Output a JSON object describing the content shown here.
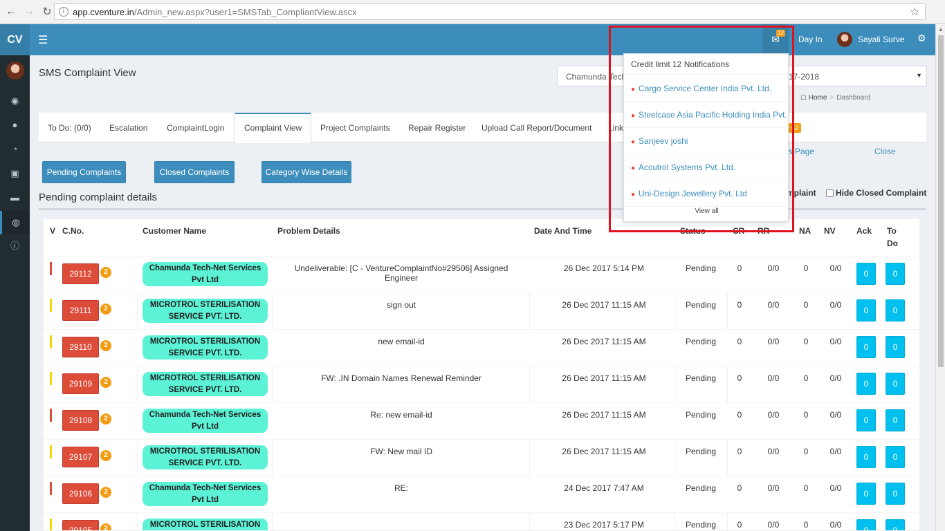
{
  "browser": {
    "url_host": "app.cventure.in",
    "url_path": "/Admin_new.aspx?user1=SMSTab_CompliantView.ascx"
  },
  "sidebar": {
    "logo": "CV"
  },
  "header": {
    "notification_count": "12",
    "day_in": "Day In",
    "user_name": "Sayali Surve"
  },
  "page": {
    "title": "SMS Complaint View",
    "company_select_left": "Chamunda Tech-",
    "company_select_right": "17-2018",
    "breadcrumb_home": "Home",
    "breadcrumb_current": "Dashboard"
  },
  "tabs": [
    {
      "label": "To Do: (0/0)"
    },
    {
      "label": "Escalation"
    },
    {
      "label": "ComplaintLogin"
    },
    {
      "label": "Complaint View"
    },
    {
      "label": "Project Complaints"
    },
    {
      "label": "Repair Register"
    },
    {
      "label": "Upload Call Report/Document"
    },
    {
      "label": "Link"
    },
    {
      "label": "o"
    }
  ],
  "tab_badge": "62",
  "links": {
    "page": "ls Page",
    "close": "Close"
  },
  "buttons": {
    "pending": "Pending Complaints",
    "closed": "Closed Complaints",
    "category": "Category Wise Details"
  },
  "section": {
    "title": "Pending complaint details",
    "hide_partial": "mplaint",
    "hide_closed": "Hide Closed Complaint"
  },
  "table": {
    "headers": {
      "v": "V",
      "cno": "C.No.",
      "customer": "Customer Name",
      "problem": "Problem Details",
      "date": "Date And Time",
      "status": "Status",
      "cr": "CR",
      "rr": "RR",
      "na": "NA",
      "nv": "NV",
      "ack": "Ack",
      "todo_1": "To",
      "todo_2": "Do"
    },
    "rows": [
      {
        "cno": "29112",
        "count": "2",
        "customer": "Chamunda Tech-Net Services Pvt Ltd",
        "problem": "Undeliverable: [C - VentureComplaintNo#29506] Assigned Engineer",
        "date": "26 Dec 2017 5:14 PM",
        "status": "Pending",
        "cr": "0",
        "rr": "0/0",
        "na": "0",
        "nv": "0/0",
        "ack": "0",
        "todo": "0",
        "flag": "#dd4b39"
      },
      {
        "cno": "29111",
        "count": "2",
        "customer": "MICROTROL STERILISATION SERVICE PVT. LTD.",
        "problem": "sign out",
        "date": "26 Dec 2017 11:15 AM",
        "status": "Pending",
        "cr": "0",
        "rr": "0/0",
        "na": "0",
        "nv": "0/0",
        "ack": "0",
        "todo": "0",
        "flag": "#f5d800"
      },
      {
        "cno": "29110",
        "count": "2",
        "customer": "MICROTROL STERILISATION SERVICE PVT. LTD.",
        "problem": "new email-id",
        "date": "26 Dec 2017 11:15 AM",
        "status": "Pending",
        "cr": "0",
        "rr": "0/0",
        "na": "0",
        "nv": "0/0",
        "ack": "0",
        "todo": "0",
        "flag": "#f5d800"
      },
      {
        "cno": "29109",
        "count": "2",
        "customer": "MICROTROL STERILISATION SERVICE PVT. LTD.",
        "problem": "FW: .IN Domain Names Renewal Reminder",
        "date": "26 Dec 2017 11:15 AM",
        "status": "Pending",
        "cr": "0",
        "rr": "0/0",
        "na": "0",
        "nv": "0/0",
        "ack": "0",
        "todo": "0",
        "flag": "#f5d800"
      },
      {
        "cno": "29108",
        "count": "2",
        "customer": "Chamunda Tech-Net Services Pvt Ltd",
        "problem": "Re: new email-id",
        "date": "26 Dec 2017 11:15 AM",
        "status": "Pending",
        "cr": "0",
        "rr": "0/0",
        "na": "0",
        "nv": "0/0",
        "ack": "0",
        "todo": "0",
        "flag": "#dd4b39"
      },
      {
        "cno": "29107",
        "count": "2",
        "customer": "MICROTROL STERILISATION SERVICE PVT. LTD.",
        "problem": "FW: New mail ID",
        "date": "26 Dec 2017 11:15 AM",
        "status": "Pending",
        "cr": "0",
        "rr": "0/0",
        "na": "0",
        "nv": "0/0",
        "ack": "0",
        "todo": "0",
        "flag": "#f5d800"
      },
      {
        "cno": "29106",
        "count": "2",
        "customer": "Chamunda Tech-Net Services Pvt Ltd",
        "problem": "RE:",
        "date": "24 Dec 2017 7:47 AM",
        "status": "Pending",
        "cr": "0",
        "rr": "0/0",
        "na": "0",
        "nv": "0/0",
        "ack": "0",
        "todo": "0",
        "flag": "#dd4b39"
      },
      {
        "cno": "29105",
        "count": "2",
        "customer": "MICROTROL STERILISATION",
        "problem": "",
        "date": "23 Dec 2017 5:17 PM",
        "status": "Pending",
        "cr": "0",
        "rr": "0/0",
        "na": "0",
        "nv": "0/0",
        "ack": "0",
        "todo": "0",
        "flag": "#f5d800"
      }
    ]
  },
  "notifications": {
    "header": "Credit limit 12 Notifications",
    "items": [
      {
        "label": "Cargo Service Center India Pvt. Ltd."
      },
      {
        "label": "Steelcase Asia Pacific Holding India Pvt. Ltd"
      },
      {
        "label": "Sanjeev joshi"
      },
      {
        "label": "Accutrol Systems Pvt. Ltd."
      },
      {
        "label": "Uni-Design Jewellery Pvt. Ltd"
      }
    ],
    "view_all": "View all"
  },
  "colors": {
    "brand": "#3c8dbc",
    "sidebar": "#222d32",
    "danger": "#dd4b39",
    "info": "#00c0ef",
    "warning": "#f39c12",
    "highlight": "#e0121f"
  }
}
